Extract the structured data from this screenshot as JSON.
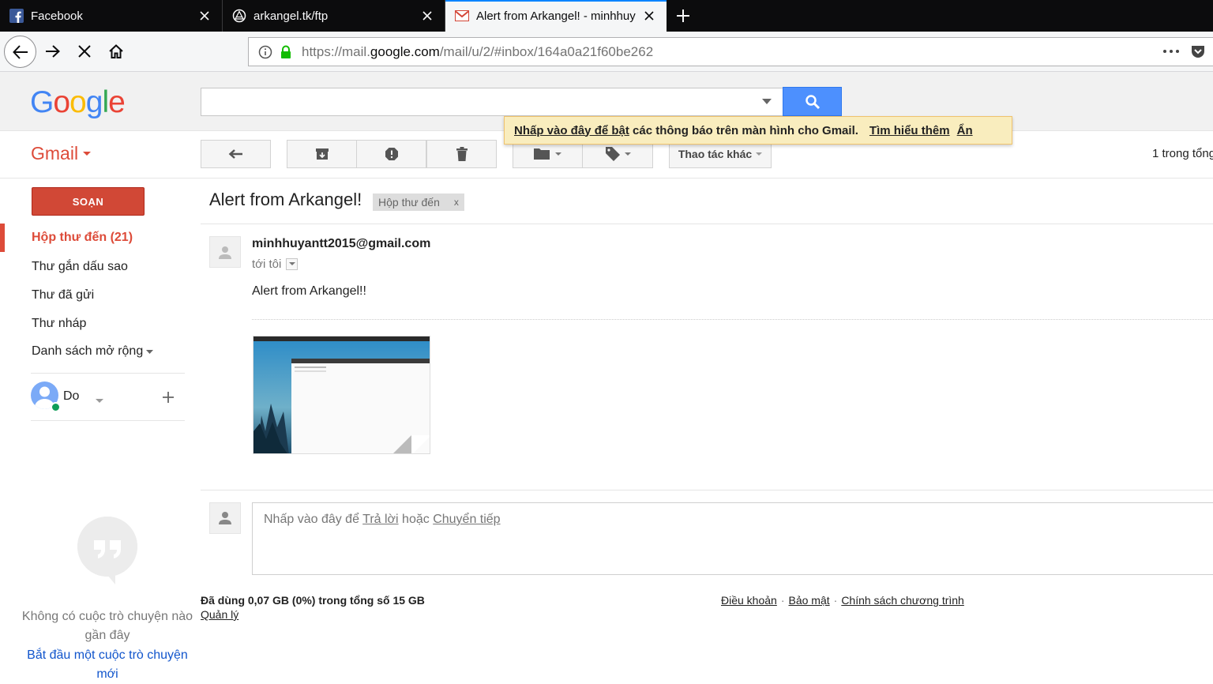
{
  "browser": {
    "tabs": [
      {
        "title": "Facebook",
        "icon": "facebook-icon",
        "active": false
      },
      {
        "title": "arkangel.tk/ftp",
        "icon": "arkangel-icon",
        "active": false
      },
      {
        "title": "Alert from Arkangel! - minhhuy",
        "icon": "gmail-icon",
        "active": true
      }
    ],
    "url_prefix": "https://mail.",
    "url_domain": "google.com",
    "url_path": "/mail/u/2/#inbox/164a0a21f60be262"
  },
  "gmail": {
    "brand": "Gmail",
    "search": {
      "value": "",
      "placeholder": ""
    },
    "notice": {
      "link_enable": "Nhấp vào đây để bật",
      "text": " các thông báo trên màn hình cho Gmail.",
      "learn_more": "Tìm hiểu thêm",
      "hide": "Ẩn"
    },
    "toolbar": {
      "more_actions": "Thao tác khác",
      "count": "1 trong tổng"
    },
    "compose_label": "SOẠN",
    "nav": {
      "inbox": "Hộp thư đến (21)",
      "starred": "Thư gắn dấu sao",
      "sent": "Thư đã gửi",
      "drafts": "Thư nháp",
      "more": "Danh sách mở rộng"
    },
    "hangouts": {
      "user": "Do",
      "empty_text": "Không có cuộc trò chuyện nào gần đây",
      "start_link": "Bắt đầu một cuộc trò chuyện mới"
    },
    "message": {
      "subject": "Alert from Arkangel!",
      "label": "Hộp thư đến",
      "label_remove": "x",
      "sender": "minhhuyantt2015@gmail.com",
      "to": "tới tôi",
      "body": "Alert from Arkangel!!"
    },
    "reply": {
      "prefix": "Nhấp vào đây để ",
      "reply_link": "Trả lời",
      "or": " hoặc ",
      "forward_link": "Chuyển tiếp"
    },
    "footer": {
      "storage": "Đã dùng 0,07 GB (0%) trong tổng số 15 GB",
      "manage": "Quản lý",
      "terms": "Điều khoản",
      "privacy": "Bảo mật",
      "policy": "Chính sách chương trình"
    }
  },
  "colors": {
    "gmail_red": "#dd4b39",
    "compose_red": "#d14836",
    "search_blue": "#4d90fe",
    "notice_yellow": "#f9edbe"
  }
}
